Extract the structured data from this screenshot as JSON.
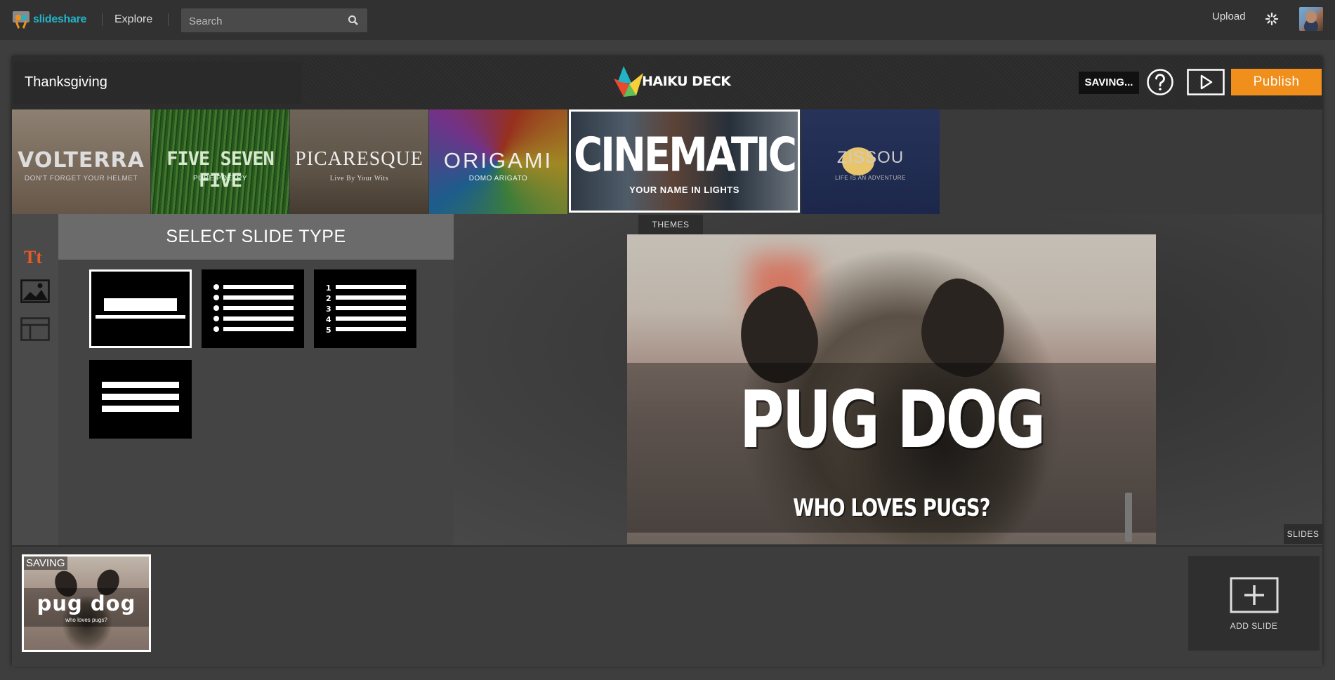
{
  "topbar": {
    "logo_text": "slideshare",
    "explore_label": "Explore",
    "search_placeholder": "Search",
    "upload_label": "Upload"
  },
  "editor": {
    "deck_title": "Thanksgiving",
    "brand_text": "HAIKU DECK",
    "status_badge": "SAVING...",
    "publish_label": "Publish"
  },
  "themes": [
    {
      "name": "VOLTERRA",
      "subtitle": "DON'T FORGET YOUR HELMET"
    },
    {
      "name": "FIVE SEVEN FIVE",
      "subtitle": "PURE POETRY"
    },
    {
      "name": "PICARESQUE",
      "subtitle": "Live By Your Wits"
    },
    {
      "name": "ORIGAMI",
      "subtitle": "DOMO ARIGATO"
    },
    {
      "name": "CINEMATIC",
      "subtitle": "YOUR NAME IN LIGHTS",
      "selected": true
    },
    {
      "name": "ZISSOU",
      "subtitle": "LIFE IS AN ADVENTURE"
    }
  ],
  "themes_tab_label": "THEMES",
  "panel": {
    "header": "SELECT SLIDE TYPE",
    "slide_types": [
      "title",
      "bulleted-list",
      "numbered-list",
      "text-block"
    ],
    "selected_type": "title"
  },
  "slide_preview": {
    "title": "PUG DOG",
    "subtitle": "WHO LOVES PUGS?"
  },
  "slides_tab_label": "SLIDES",
  "filmstrip": {
    "thumb_status": "SAVING",
    "thumb_title": "pug dog",
    "thumb_subtitle": "who loves pugs?",
    "add_slide_label": "ADD SLIDE"
  },
  "colors": {
    "accent_orange": "#f08f1c",
    "text_tool_red": "#e75a2a",
    "slideshare_teal": "#23b3c7"
  },
  "icons": [
    "slideshare-logo-icon",
    "search-icon",
    "gear-icon",
    "help-icon",
    "play-icon",
    "haiku-deck-logo-icon",
    "text-tool-icon",
    "image-tool-icon",
    "layout-tool-icon",
    "plus-icon"
  ]
}
